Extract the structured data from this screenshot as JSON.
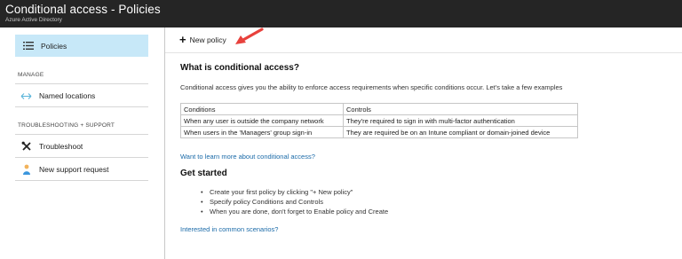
{
  "header": {
    "title": "Conditional access - Policies",
    "subtitle": "Azure Active Directory"
  },
  "sidebar": {
    "selected": {
      "label": "Policies",
      "icon": "policies-list-icon"
    },
    "sections": [
      {
        "title": "MANAGE",
        "items": [
          {
            "label": "Named locations",
            "icon": "named-locations-icon"
          }
        ]
      },
      {
        "title": "TROUBLESHOOTING + SUPPORT",
        "items": [
          {
            "label": "Troubleshoot",
            "icon": "wrench-icon"
          },
          {
            "label": "New support request",
            "icon": "support-person-icon"
          }
        ]
      }
    ]
  },
  "toolbar": {
    "new_policy_label": "New policy"
  },
  "main": {
    "heading": "What is conditional access?",
    "intro": "Conditional access gives you the ability to enforce access requirements when specific conditions occur. Let's take a few examples",
    "table": {
      "headers": [
        "Conditions",
        "Controls"
      ],
      "rows": [
        [
          "When any user is outside the company network",
          "They're required to sign in with multi-factor authentication"
        ],
        [
          "When users in the 'Managers' group sign-in",
          "They are required be on an Intune compliant or domain-joined device"
        ]
      ]
    },
    "learn_more_link": "Want to learn more about conditional access?",
    "get_started_heading": "Get started",
    "get_started_items": [
      "Create your first policy by clicking \"+ New policy\"",
      "Specify policy Conditions and Controls",
      "When you are done, don't forget to Enable policy and Create"
    ],
    "scenarios_link": "Interested in common scenarios?"
  },
  "colors": {
    "header_bg": "#252525",
    "selected_bg": "#c7e8f8",
    "link": "#1a6aa8",
    "annotation_arrow": "#e8413c"
  }
}
